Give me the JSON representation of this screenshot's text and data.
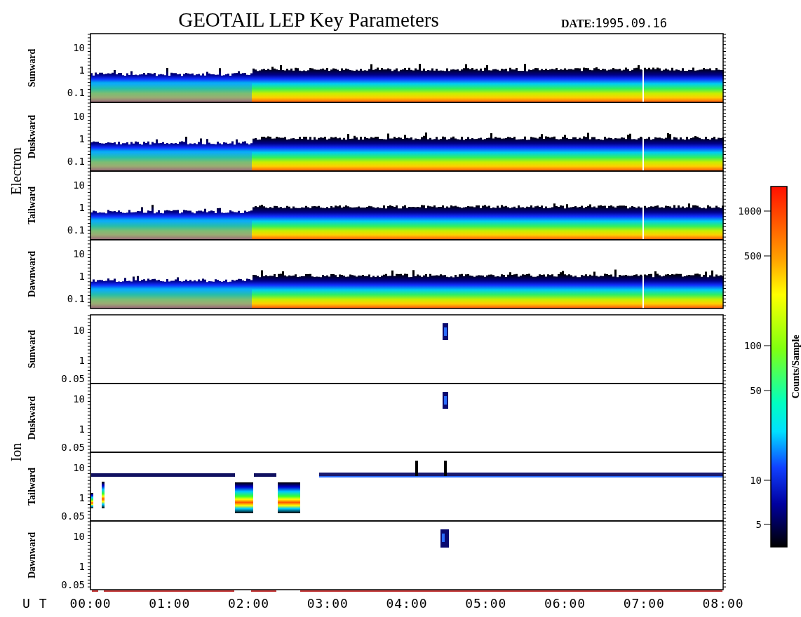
{
  "title": "GEOTAIL LEP Key Parameters",
  "date": {
    "label": "DATE:",
    "value": "1995.09.16"
  },
  "groups": [
    {
      "label": "Electron",
      "kind": "electron",
      "panels": [
        {
          "label": "Sunward",
          "yticks": [
            "10",
            "1",
            "0.1"
          ]
        },
        {
          "label": "Duskward",
          "yticks": [
            "10",
            "1",
            "0.1"
          ]
        },
        {
          "label": "Tailward",
          "yticks": [
            "10",
            "1",
            "0.1"
          ]
        },
        {
          "label": "Dawnward",
          "yticks": [
            "10",
            "1",
            "0.1"
          ]
        }
      ]
    },
    {
      "label": "Ion",
      "kind": "ion",
      "panels": [
        {
          "label": "Sunward",
          "yticks": [
            "10",
            "1",
            "0.05"
          ]
        },
        {
          "label": "Duskward",
          "yticks": [
            "10",
            "1",
            "0.05"
          ]
        },
        {
          "label": "Tailward",
          "yticks": [
            "10",
            "1",
            "0.05"
          ]
        },
        {
          "label": "Dawnward",
          "yticks": [
            "10",
            "1",
            "0.05"
          ]
        }
      ]
    }
  ],
  "x_axis": {
    "label": "U T",
    "ticks": [
      "00:00",
      "01:00",
      "02:00",
      "03:00",
      "04:00",
      "05:00",
      "06:00",
      "07:00",
      "08:00"
    ]
  },
  "colorbar": {
    "title": "Counts/Sample",
    "ticks": [
      "1000",
      "500",
      "100",
      "50",
      "10",
      "5"
    ]
  }
}
